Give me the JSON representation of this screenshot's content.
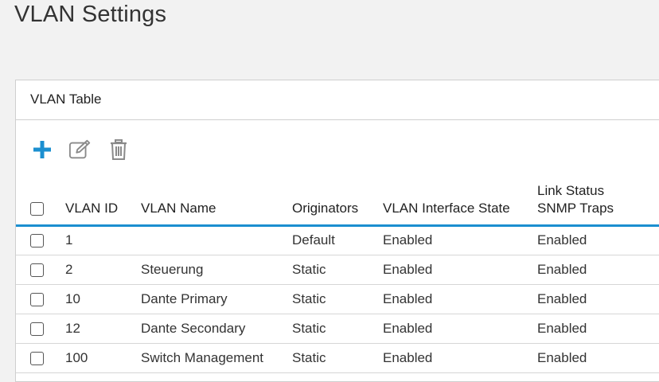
{
  "page": {
    "title": "VLAN Settings"
  },
  "panel": {
    "title": "VLAN Table"
  },
  "toolbar": {
    "add_icon": "plus-icon",
    "edit_icon": "edit-icon",
    "delete_icon": "trash-icon",
    "accent_color": "#1b8fd0"
  },
  "table": {
    "headers": {
      "vlan_id": "VLAN ID",
      "vlan_name": "VLAN Name",
      "originators": "Originators",
      "interface_state": "VLAN Interface State",
      "link_status_line1": "Link Status",
      "link_status_line2": "SNMP Traps"
    },
    "rows": [
      {
        "vlan_id": "1",
        "vlan_name": "",
        "originators": "Default",
        "interface_state": "Enabled",
        "link_status": "Enabled"
      },
      {
        "vlan_id": "2",
        "vlan_name": "Steuerung",
        "originators": "Static",
        "interface_state": "Enabled",
        "link_status": "Enabled"
      },
      {
        "vlan_id": "10",
        "vlan_name": "Dante Primary",
        "originators": "Static",
        "interface_state": "Enabled",
        "link_status": "Enabled"
      },
      {
        "vlan_id": "12",
        "vlan_name": "Dante Secondary",
        "originators": "Static",
        "interface_state": "Enabled",
        "link_status": "Enabled"
      },
      {
        "vlan_id": "100",
        "vlan_name": "Switch Management",
        "originators": "Static",
        "interface_state": "Enabled",
        "link_status": "Enabled"
      }
    ]
  }
}
